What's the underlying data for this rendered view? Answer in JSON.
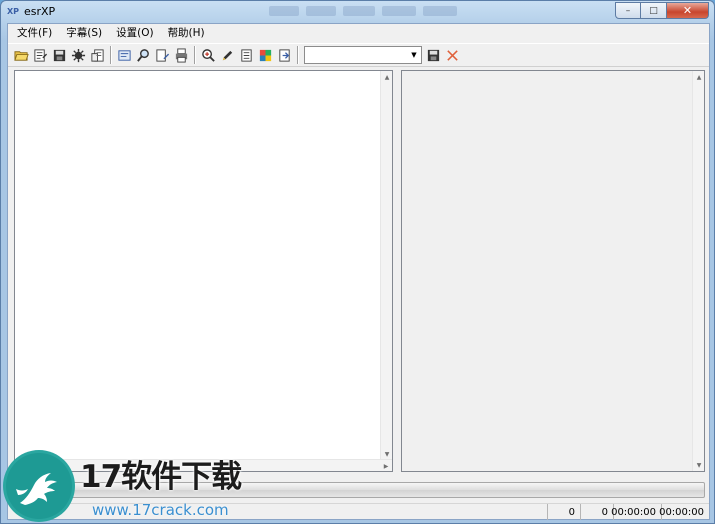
{
  "window": {
    "title": "esrXP",
    "icon_text": "XP",
    "buttons": {
      "minimize": "–",
      "maximize": "□",
      "close": "✕"
    }
  },
  "menu": {
    "items": [
      {
        "label": "文件(F)"
      },
      {
        "label": "字幕(S)"
      },
      {
        "label": "设置(O)"
      },
      {
        "label": "帮助(H)"
      }
    ]
  },
  "toolbar": {
    "combo_value": "",
    "icons": [
      "open-folder-icon",
      "save-as-icon",
      "save-icon",
      "process-icon",
      "properties-icon",
      "subtitle-icon",
      "search-icon",
      "edit-file-icon",
      "print-icon",
      "zoom-icon",
      "pen-icon",
      "document-icon",
      "color-icon",
      "export-icon"
    ]
  },
  "progress": {
    "value": 0
  },
  "status": {
    "cells": [
      "0",
      "0",
      "00:00:00",
      "00:00:00"
    ]
  },
  "watermark": {
    "title": "17软件下载",
    "url": "www.17crack.com"
  },
  "colors": {
    "accent_green": "#3fb34f",
    "close_red": "#c8452d",
    "link_blue": "#3a8fd0"
  }
}
